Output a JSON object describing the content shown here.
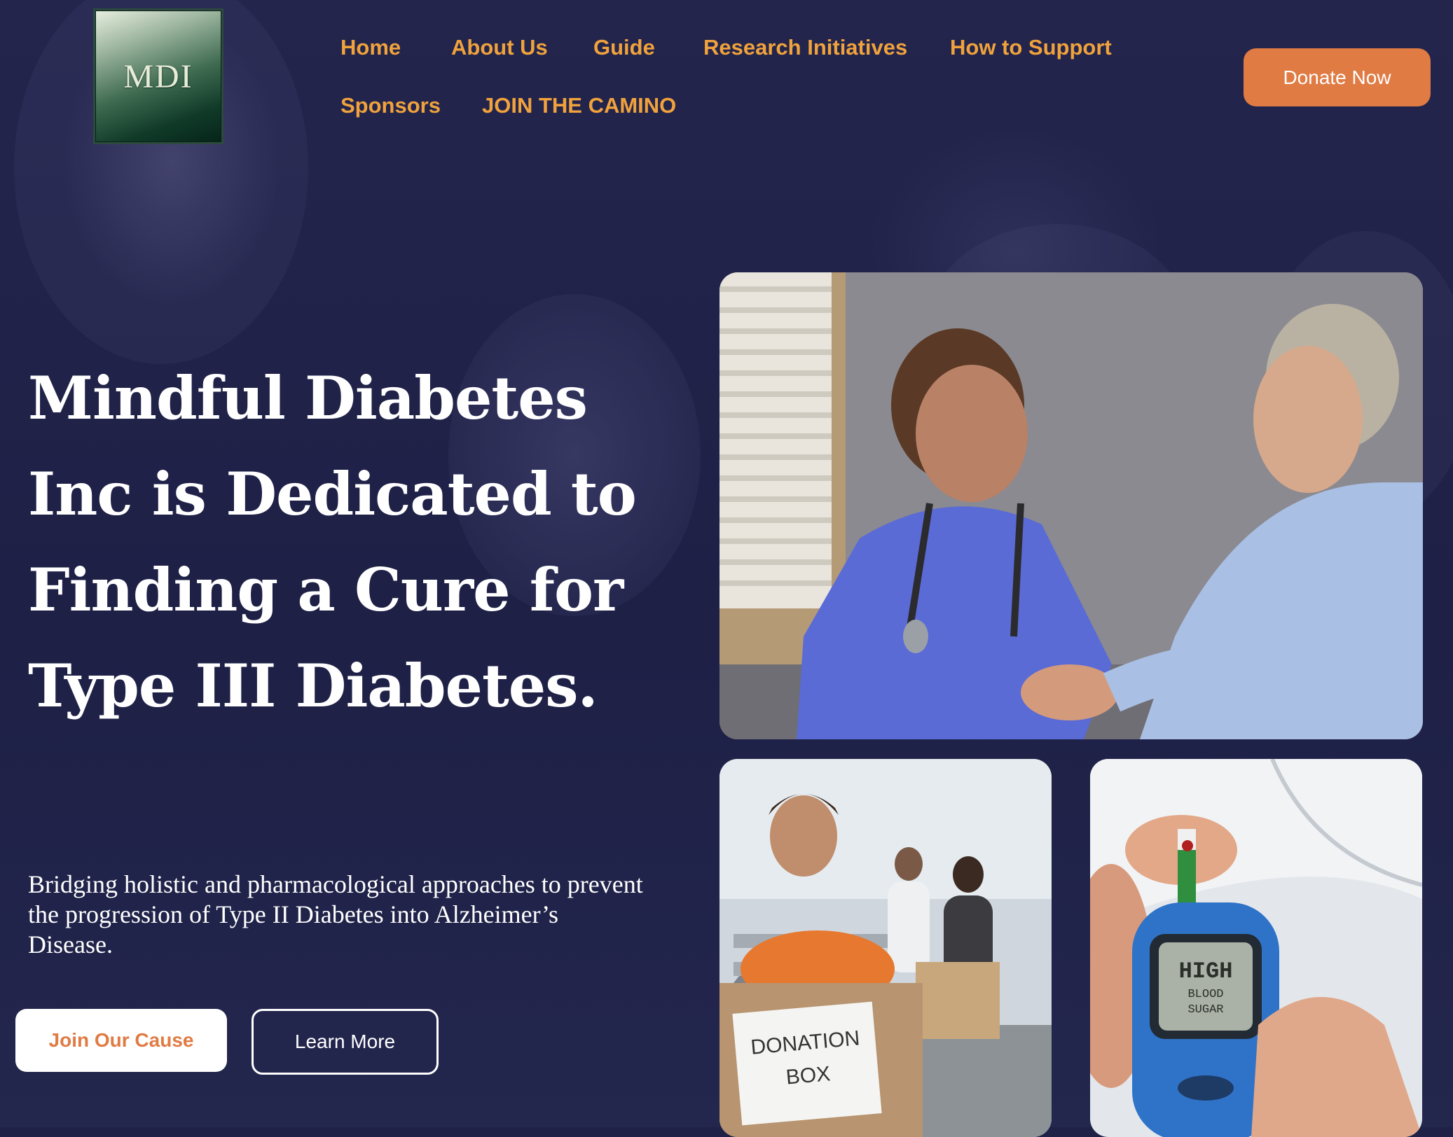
{
  "brand": {
    "logo_text": "MDI"
  },
  "nav": {
    "items": [
      {
        "label": "Home"
      },
      {
        "label": "About Us"
      },
      {
        "label": "Guide"
      },
      {
        "label": "Research Initiatives"
      },
      {
        "label": "How to Support"
      },
      {
        "label": "Sponsors"
      },
      {
        "label": "JOIN THE CAMINO"
      }
    ],
    "donate_label": "Donate Now"
  },
  "hero": {
    "title": "Mindful Diabetes Inc is Dedicated to Finding a Cure for Type III Diabetes.",
    "subtitle": "Bridging holistic and pharmacological approaches to prevent the progression of Type II Diabetes into Alzheimer’s Disease.",
    "primary_cta": "Join Our Cause",
    "secondary_cta": "Learn More"
  },
  "gallery": {
    "donation_box_text": [
      "DONATION",
      "BOX"
    ],
    "meter_text": [
      "HIGH",
      "BLOOD",
      "SUGAR"
    ]
  },
  "colors": {
    "background": "#1f2147",
    "nav_link": "#f0a23c",
    "accent": "#e07b44",
    "text": "#ffffff"
  }
}
